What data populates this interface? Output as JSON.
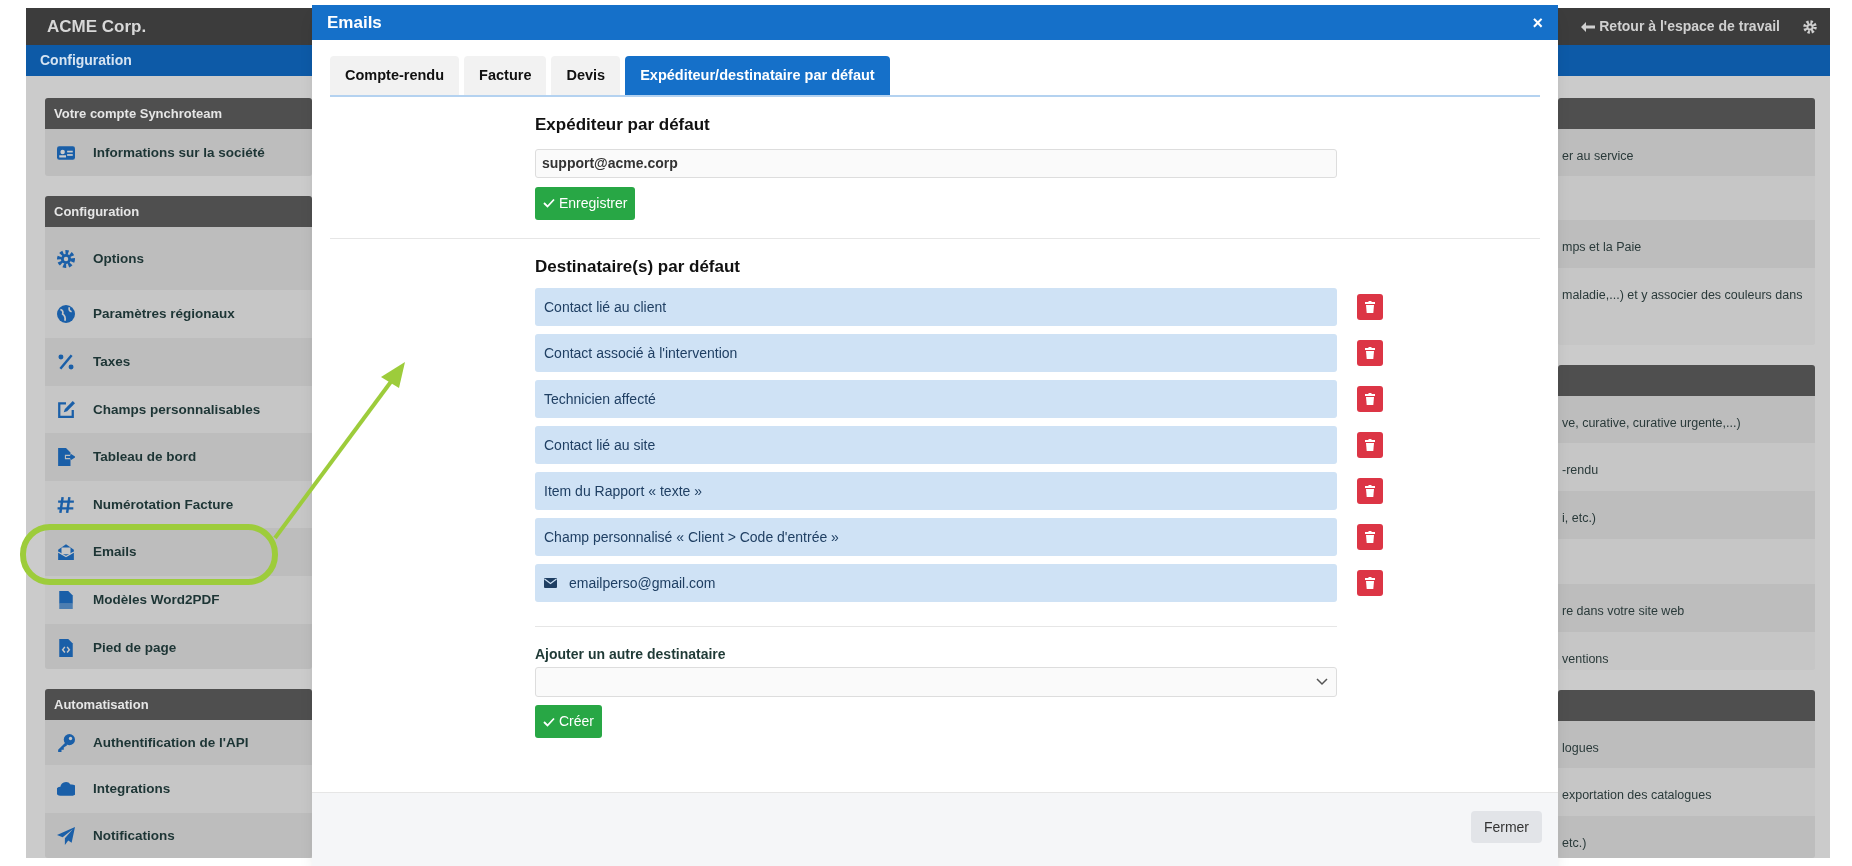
{
  "app": {
    "brand": "ACME Corp.",
    "back_link": "Retour à l'espace de travail",
    "section": "Configuration"
  },
  "left_panels": [
    {
      "title": "Votre compte Synchroteam",
      "items": [
        "Informations sur la société"
      ]
    },
    {
      "title": "Configuration",
      "items": [
        "Options",
        "Paramètres régionaux",
        "Taxes",
        "Champs personnalisables",
        "Tableau de bord",
        "Numérotation Facture",
        "Emails",
        "Modèles Word2PDF",
        "Pied de page"
      ]
    },
    {
      "title": "Automatisation",
      "items": [
        "Authentification de l'API",
        "Integrations",
        "Notifications"
      ]
    }
  ],
  "right_panels": [
    {
      "items": [
        "er au service",
        "mps et la Paie",
        "maladie,...) et y associer des couleurs dans"
      ]
    },
    {
      "items": [
        "ve, curative, curative urgente,...)",
        "-rendu",
        "i, etc.)",
        "re dans votre site web",
        "ventions"
      ]
    },
    {
      "items": [
        "logues",
        "exportation des catalogues",
        "etc.)"
      ]
    }
  ],
  "modal": {
    "title": "Emails",
    "close": "×",
    "tabs": [
      {
        "label": "Compte-rendu",
        "selected": false
      },
      {
        "label": "Facture",
        "selected": false
      },
      {
        "label": "Devis",
        "selected": false
      },
      {
        "label": "Expéditeur/destinataire par défaut",
        "selected": true
      }
    ],
    "sender": {
      "heading": "Expéditeur par défaut",
      "value": "support@acme.corp",
      "button": "Enregistrer"
    },
    "recipients": {
      "heading": "Destinataire(s) par défaut",
      "items": [
        {
          "kind": "contact",
          "label": "Contact lié au client"
        },
        {
          "kind": "contact",
          "label": "Contact associé à l'intervention"
        },
        {
          "kind": "contact",
          "label": "Technicien affecté"
        },
        {
          "kind": "contact",
          "label": "Contact lié au site"
        },
        {
          "kind": "contact",
          "label": "Item du Rapport « texte »"
        },
        {
          "kind": "contact",
          "label": "Champ personnalisé « Client > Code d'entrée »"
        },
        {
          "kind": "email",
          "label": "emailperso@gmail.com"
        }
      ]
    },
    "add": {
      "label": "Ajouter un autre destinataire",
      "button": "Créer"
    },
    "footer_button": "Fermer"
  }
}
